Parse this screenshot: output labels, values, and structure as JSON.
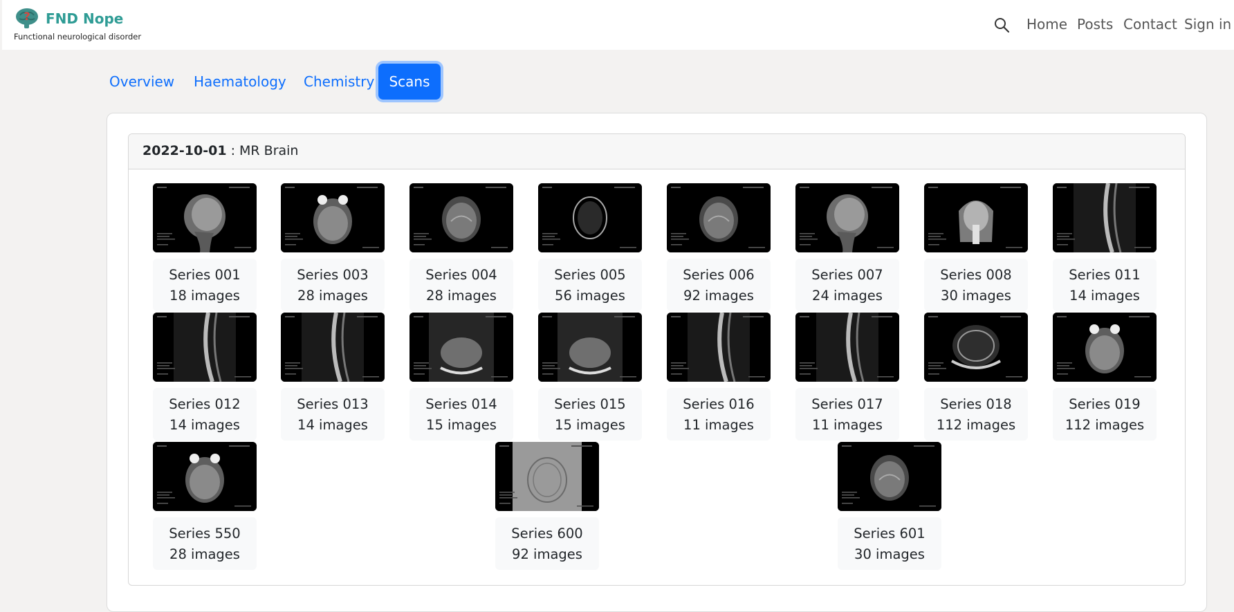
{
  "brand": {
    "name": "FND Nope",
    "tagline": "Functional neurological disorder",
    "logo_icon": "brain-icon"
  },
  "nav": {
    "search_icon": "search-icon",
    "links": [
      "Home",
      "Posts",
      "Contact",
      "Sign in"
    ]
  },
  "tabs": [
    {
      "label": "Overview",
      "active": false
    },
    {
      "label": "Haematology",
      "active": false
    },
    {
      "label": "Chemistry",
      "active": false
    },
    {
      "label": "Scans",
      "active": true
    }
  ],
  "study": {
    "date": "2022-10-01",
    "separator": " : ",
    "description": "MR Brain"
  },
  "series": [
    {
      "name": "Series 001",
      "images": "18 images",
      "view": "sagittal"
    },
    {
      "name": "Series 003",
      "images": "28 images",
      "view": "axial-eyes"
    },
    {
      "name": "Series 004",
      "images": "28 images",
      "view": "axial"
    },
    {
      "name": "Series 005",
      "images": "56 images",
      "view": "axial-ring"
    },
    {
      "name": "Series 006",
      "images": "92 images",
      "view": "axial"
    },
    {
      "name": "Series 007",
      "images": "24 images",
      "view": "sagittal"
    },
    {
      "name": "Series 008",
      "images": "30 images",
      "view": "coronal"
    },
    {
      "name": "Series 011",
      "images": "14 images",
      "view": "spine"
    },
    {
      "name": "Series 012",
      "images": "14 images",
      "view": "spine"
    },
    {
      "name": "Series 013",
      "images": "14 images",
      "view": "spine"
    },
    {
      "name": "Series 014",
      "images": "15 images",
      "view": "neck-axial"
    },
    {
      "name": "Series 015",
      "images": "15 images",
      "view": "neck-axial"
    },
    {
      "name": "Series 016",
      "images": "11 images",
      "view": "spine"
    },
    {
      "name": "Series 017",
      "images": "11 images",
      "view": "spine"
    },
    {
      "name": "Series 018",
      "images": "112 images",
      "view": "axial-wide"
    },
    {
      "name": "Series 019",
      "images": "112 images",
      "view": "axial-eyes"
    },
    {
      "name": "Series 550",
      "images": "28 images",
      "view": "axial-eyes"
    },
    {
      "name": "Series 600",
      "images": "92 images",
      "view": "axial-grey"
    },
    {
      "name": "Series 601",
      "images": "30 images",
      "view": "axial"
    }
  ]
}
